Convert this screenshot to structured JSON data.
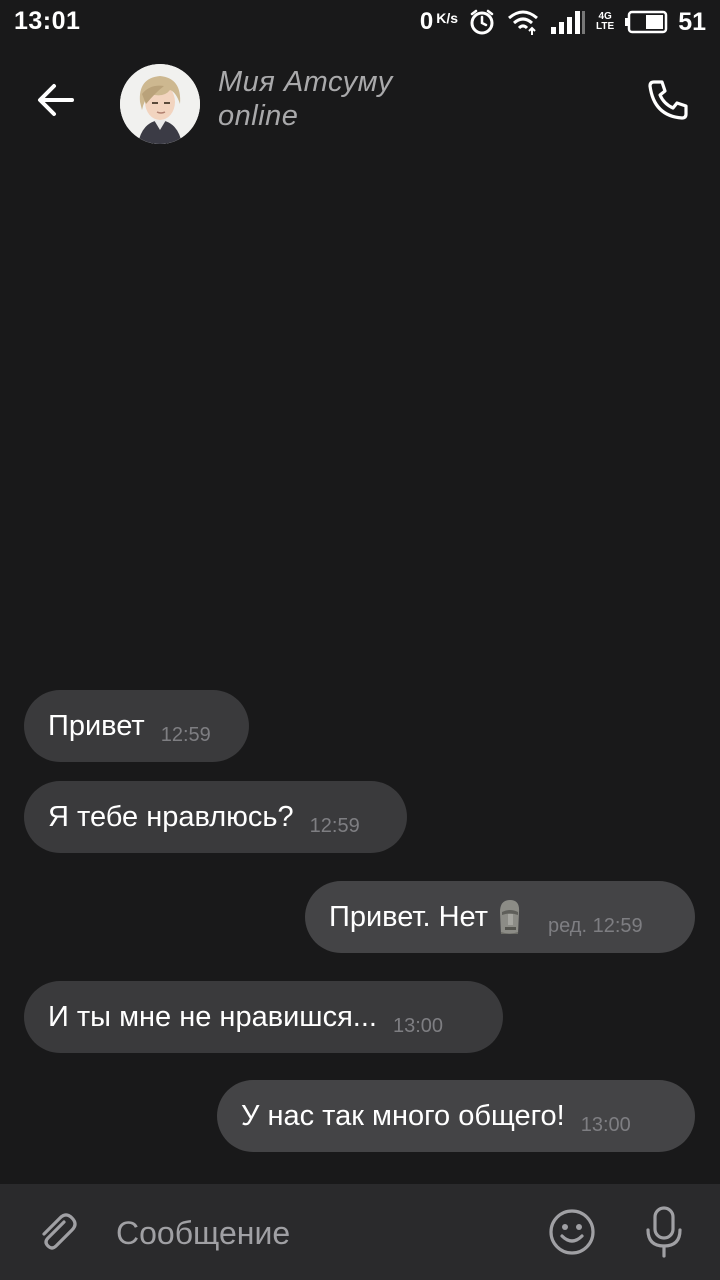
{
  "status_bar": {
    "time": "13:01",
    "net_speed_value": "0",
    "net_speed_unit": "K/s",
    "network_type_top": "4G",
    "network_type_bottom": "LTE",
    "battery_percent": "51"
  },
  "header": {
    "contact_name": "Мия Атсуму",
    "contact_status": "online"
  },
  "messages": [
    {
      "direction": "incoming",
      "text": "Привет",
      "time": "12:59"
    },
    {
      "direction": "incoming",
      "text": "Я тебе нравлюсь?",
      "time": "12:59"
    },
    {
      "direction": "outgoing",
      "text": "Привет. Нет",
      "emoji": "moai",
      "time": "ред. 12:59"
    },
    {
      "direction": "incoming",
      "text": "И ты мне не нравишся...",
      "time": "13:00"
    },
    {
      "direction": "outgoing",
      "text": "У нас так много общего!",
      "time": "13:00"
    }
  ],
  "input_bar": {
    "placeholder": "Сообщение"
  },
  "colors": {
    "background": "#19191a",
    "incoming_bubble": "#3a3a3c",
    "outgoing_bubble": "#444446",
    "header_text": "#a9a9ab",
    "input_bar": "#2a2a2c"
  },
  "icons": [
    "back-arrow-icon",
    "phone-icon",
    "paperclip-icon",
    "smiley-icon",
    "microphone-icon",
    "alarm-icon",
    "wifi-icon",
    "signal-icon",
    "battery-icon",
    "moai-emoji"
  ]
}
